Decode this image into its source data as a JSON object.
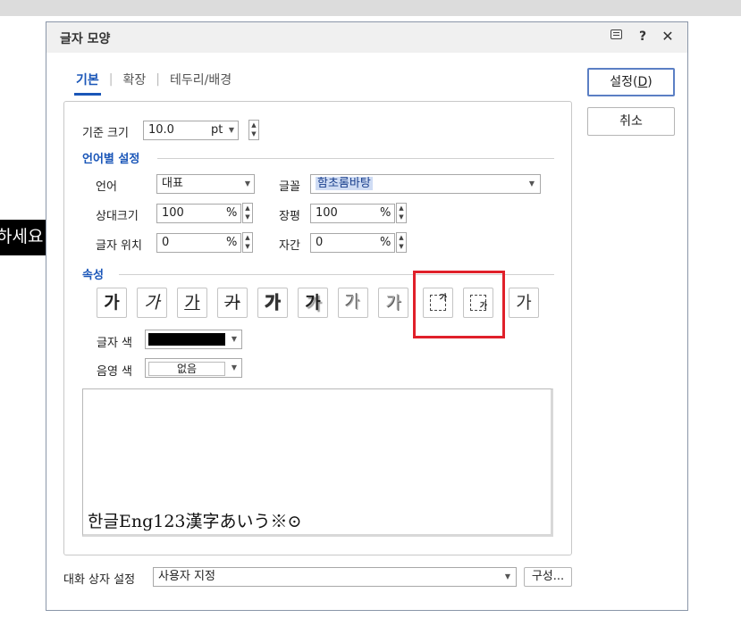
{
  "background": {
    "doc_text": "하세요"
  },
  "dialog": {
    "title": "글자 모양",
    "tabs": [
      {
        "label": "기본",
        "active": true
      },
      {
        "label": "확장",
        "active": false
      },
      {
        "label": "테두리/배경",
        "active": false
      }
    ],
    "base_size": {
      "label": "기준 크기",
      "value": "10.0",
      "unit": "pt"
    },
    "lang_section": {
      "title": "언어별 설정",
      "language_label": "언어",
      "language_value": "대표",
      "font_label": "글꼴",
      "font_value": "함초롬바탕",
      "rel_size_label": "상대크기",
      "rel_size_value": "100",
      "rel_size_unit": "%",
      "width_label": "장평",
      "width_value": "100",
      "width_unit": "%",
      "position_label": "글자 위치",
      "position_value": "0",
      "position_unit": "%",
      "spacing_label": "자간",
      "spacing_value": "0",
      "spacing_unit": "%"
    },
    "attr_section": {
      "title": "속성",
      "buttons": [
        {
          "glyph": "가",
          "icon": "bold-icon"
        },
        {
          "glyph": "가",
          "icon": "italic-icon"
        },
        {
          "glyph": "가",
          "icon": "underline-icon"
        },
        {
          "glyph": "가",
          "icon": "strikethrough-icon"
        },
        {
          "glyph": "가",
          "icon": "outline-icon"
        },
        {
          "glyph": "가",
          "icon": "shadow-icon"
        },
        {
          "glyph": "가",
          "icon": "emboss-icon"
        },
        {
          "glyph": "가",
          "icon": "engrave-icon"
        },
        {
          "glyph": "가",
          "icon": "superscript-icon"
        },
        {
          "glyph": "가",
          "icon": "subscript-icon"
        },
        {
          "glyph": "가",
          "icon": "normal-icon"
        }
      ],
      "text_color_label": "글자 색",
      "text_color": "#000000",
      "shade_color_label": "음영 색",
      "shade_color_value": "없음"
    },
    "preview_text": "한글Eng123漢字あいう※⊙",
    "dialog_setting_label": "대화 상자 설정",
    "dialog_setting_value": "사용자 지정",
    "config_button": "구성...",
    "ok_button_prefix": "설정(",
    "ok_button_key": "D",
    "ok_button_suffix": ")",
    "cancel_button": "취소"
  }
}
